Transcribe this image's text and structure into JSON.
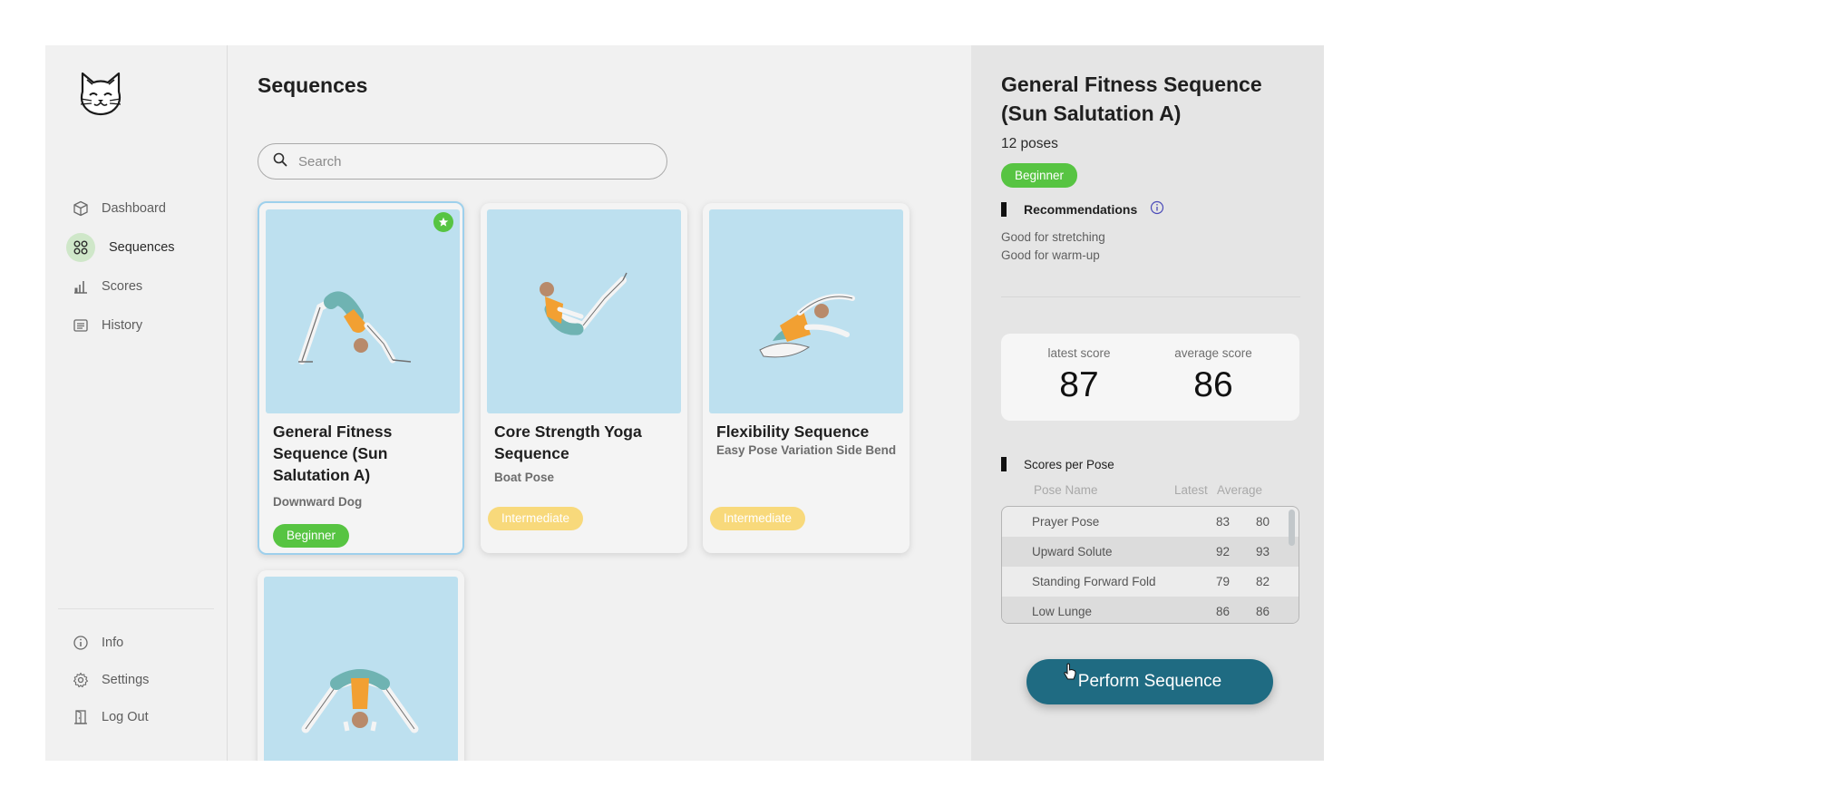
{
  "sidebar": {
    "logo": "cat-face-logo",
    "nav": [
      {
        "label": "Dashboard",
        "icon": "cube-icon"
      },
      {
        "label": "Sequences",
        "icon": "grid-icon",
        "active": true
      },
      {
        "label": "Scores",
        "icon": "bar-chart-icon"
      },
      {
        "label": "History",
        "icon": "list-icon"
      }
    ],
    "bottom": [
      {
        "label": "Info",
        "icon": "info-icon"
      },
      {
        "label": "Settings",
        "icon": "gear-icon"
      },
      {
        "label": "Log Out",
        "icon": "door-icon"
      }
    ]
  },
  "main": {
    "title": "Sequences",
    "search_placeholder": "Search",
    "cards": [
      {
        "title": "General Fitness Sequence (Sun Salutation A)",
        "subtitle": "Downward Dog",
        "level": "Beginner",
        "favorite": true,
        "selected": true
      },
      {
        "title": "Core Strength Yoga Sequence",
        "subtitle": "Boat Pose",
        "level": "Intermediate"
      },
      {
        "title": "Flexibility Sequence",
        "subtitle": "Easy Pose Variation Side Bend",
        "level": "Intermediate"
      },
      {
        "title": "",
        "subtitle": "",
        "level": ""
      }
    ]
  },
  "details": {
    "title": "General Fitness Sequence (Sun Salutation A)",
    "pose_count": "12 poses",
    "level": "Beginner",
    "recommendations_label": "Recommendations",
    "recommendations": [
      "Good for stretching",
      "Good for warm-up"
    ],
    "latest_score_label": "latest score",
    "latest_score": "87",
    "average_score_label": "average score",
    "average_score": "86",
    "scores_per_pose_label": "Scores per Pose",
    "table_headers": [
      "Pose Name",
      "Latest",
      "Average"
    ],
    "poses": [
      {
        "name": "Prayer Pose",
        "latest": "83",
        "average": "80"
      },
      {
        "name": "Upward Solute",
        "latest": "92",
        "average": "93"
      },
      {
        "name": "Standing Forward Fold",
        "latest": "79",
        "average": "82"
      },
      {
        "name": "Low Lunge",
        "latest": "86",
        "average": "86"
      }
    ],
    "perform_button": "Perform Sequence"
  },
  "colors": {
    "accent_green": "#57c442",
    "intermediate_yellow": "#f8d97b",
    "button_teal": "#1f6b82",
    "card_image_bg": "#bde0ef"
  }
}
